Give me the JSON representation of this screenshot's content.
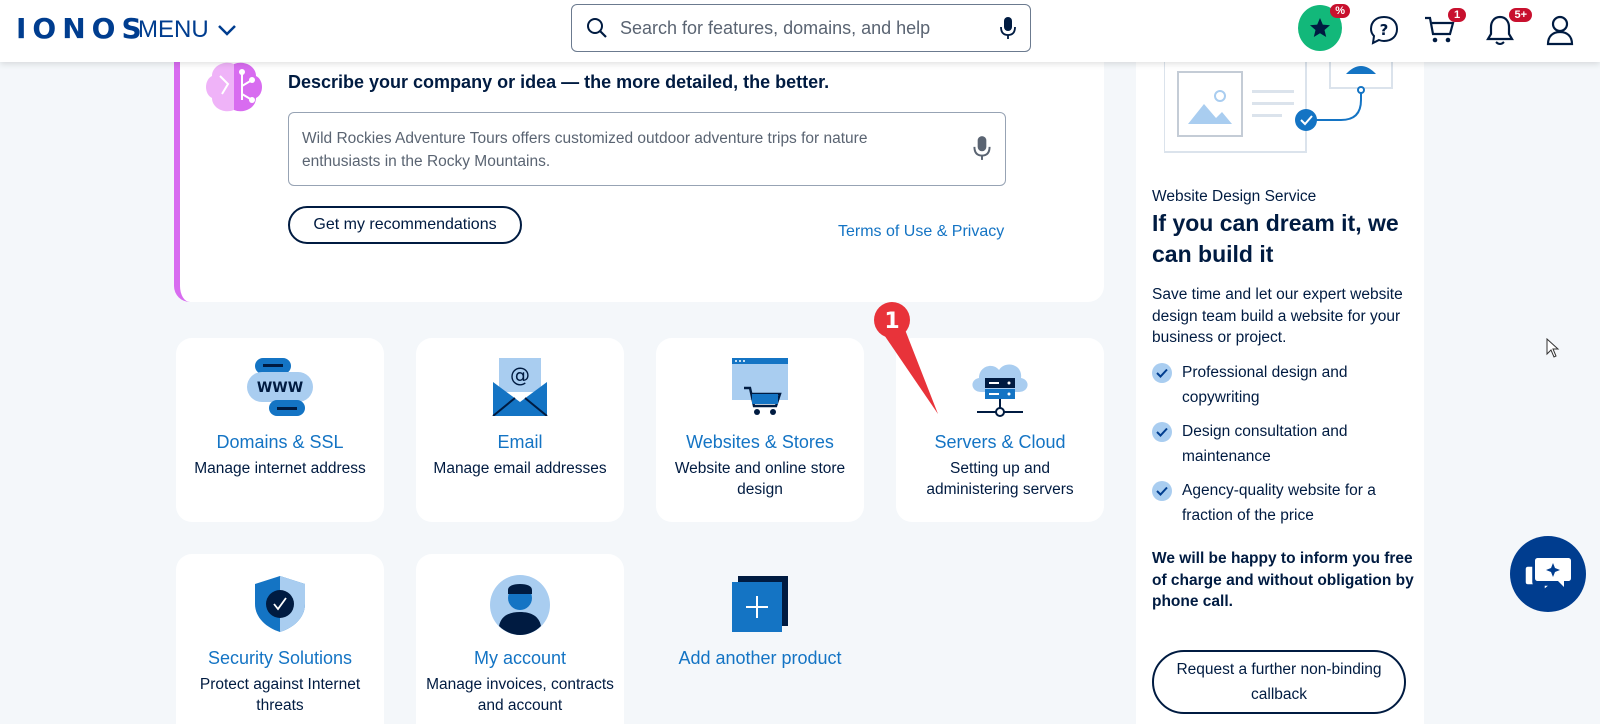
{
  "header": {
    "logo_text": "IONOS",
    "menu_label": "MENU",
    "search_placeholder": "Search for features, domains, and help",
    "promo_badge": "%",
    "cart_badge": "1",
    "notifications_badge": "5+"
  },
  "ai_card": {
    "title": "Describe your company or idea — the more detailed, the better.",
    "input_value": "Wild Rockies Adventure Tours offers customized outdoor adventure trips for nature enthusiasts in the Rocky Mountains.",
    "button_label": "Get my recommendations",
    "terms_link": "Terms of Use & Privacy"
  },
  "tiles": [
    {
      "title": "Domains & SSL",
      "desc": "Manage internet address",
      "icon": "www-icon"
    },
    {
      "title": "Email",
      "desc": "Manage email addresses",
      "icon": "email-icon"
    },
    {
      "title": "Websites & Stores",
      "desc": "Website and online store design",
      "icon": "store-icon"
    },
    {
      "title": "Servers & Cloud",
      "desc": "Setting up and administering servers",
      "icon": "cloud-server-icon"
    },
    {
      "title": "Security Solutions",
      "desc": "Protect against Internet threats",
      "icon": "shield-icon"
    },
    {
      "title": "My account",
      "desc": "Manage invoices, contracts and account",
      "icon": "user-icon"
    }
  ],
  "add_tile": {
    "title": "Add another product"
  },
  "annotation": {
    "number": "1"
  },
  "sidebar": {
    "eyebrow": "Website Design Service",
    "title": "If you can dream it, we can build it",
    "description": "Save time and let our expert website design team build a website for your business or project.",
    "features": [
      "Professional design and copywriting",
      "Design consultation and maintenance",
      "Agency-quality website for a fraction of the price"
    ],
    "bold_note": "We will be happy to inform you free of charge and without obligation by phone call.",
    "callback_button": "Request a further non-binding callback"
  },
  "colors": {
    "brand": "#003d8f",
    "link": "#1474c4",
    "accent_purple": "#d86cf0",
    "badge_red": "#c8102e",
    "promo_green": "#12b87a"
  }
}
